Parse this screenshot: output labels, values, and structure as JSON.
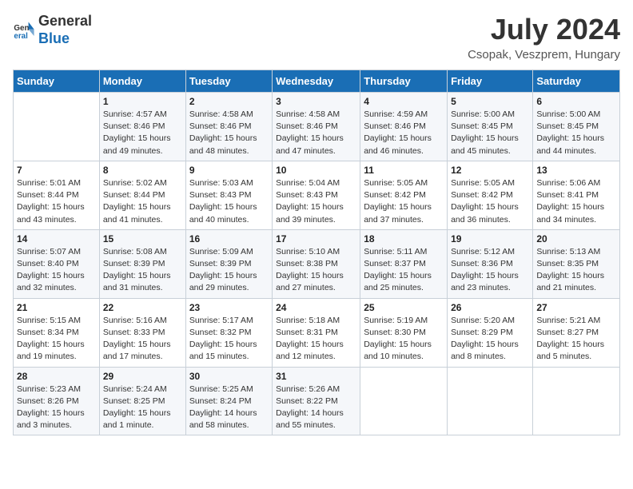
{
  "logo": {
    "text_general": "General",
    "text_blue": "Blue"
  },
  "header": {
    "month": "July 2024",
    "location": "Csopak, Veszprem, Hungary"
  },
  "days_of_week": [
    "Sunday",
    "Monday",
    "Tuesday",
    "Wednesday",
    "Thursday",
    "Friday",
    "Saturday"
  ],
  "weeks": [
    [
      {
        "day": "",
        "info": ""
      },
      {
        "day": "1",
        "info": "Sunrise: 4:57 AM\nSunset: 8:46 PM\nDaylight: 15 hours\nand 49 minutes."
      },
      {
        "day": "2",
        "info": "Sunrise: 4:58 AM\nSunset: 8:46 PM\nDaylight: 15 hours\nand 48 minutes."
      },
      {
        "day": "3",
        "info": "Sunrise: 4:58 AM\nSunset: 8:46 PM\nDaylight: 15 hours\nand 47 minutes."
      },
      {
        "day": "4",
        "info": "Sunrise: 4:59 AM\nSunset: 8:46 PM\nDaylight: 15 hours\nand 46 minutes."
      },
      {
        "day": "5",
        "info": "Sunrise: 5:00 AM\nSunset: 8:45 PM\nDaylight: 15 hours\nand 45 minutes."
      },
      {
        "day": "6",
        "info": "Sunrise: 5:00 AM\nSunset: 8:45 PM\nDaylight: 15 hours\nand 44 minutes."
      }
    ],
    [
      {
        "day": "7",
        "info": "Sunrise: 5:01 AM\nSunset: 8:44 PM\nDaylight: 15 hours\nand 43 minutes."
      },
      {
        "day": "8",
        "info": "Sunrise: 5:02 AM\nSunset: 8:44 PM\nDaylight: 15 hours\nand 41 minutes."
      },
      {
        "day": "9",
        "info": "Sunrise: 5:03 AM\nSunset: 8:43 PM\nDaylight: 15 hours\nand 40 minutes."
      },
      {
        "day": "10",
        "info": "Sunrise: 5:04 AM\nSunset: 8:43 PM\nDaylight: 15 hours\nand 39 minutes."
      },
      {
        "day": "11",
        "info": "Sunrise: 5:05 AM\nSunset: 8:42 PM\nDaylight: 15 hours\nand 37 minutes."
      },
      {
        "day": "12",
        "info": "Sunrise: 5:05 AM\nSunset: 8:42 PM\nDaylight: 15 hours\nand 36 minutes."
      },
      {
        "day": "13",
        "info": "Sunrise: 5:06 AM\nSunset: 8:41 PM\nDaylight: 15 hours\nand 34 minutes."
      }
    ],
    [
      {
        "day": "14",
        "info": "Sunrise: 5:07 AM\nSunset: 8:40 PM\nDaylight: 15 hours\nand 32 minutes."
      },
      {
        "day": "15",
        "info": "Sunrise: 5:08 AM\nSunset: 8:39 PM\nDaylight: 15 hours\nand 31 minutes."
      },
      {
        "day": "16",
        "info": "Sunrise: 5:09 AM\nSunset: 8:39 PM\nDaylight: 15 hours\nand 29 minutes."
      },
      {
        "day": "17",
        "info": "Sunrise: 5:10 AM\nSunset: 8:38 PM\nDaylight: 15 hours\nand 27 minutes."
      },
      {
        "day": "18",
        "info": "Sunrise: 5:11 AM\nSunset: 8:37 PM\nDaylight: 15 hours\nand 25 minutes."
      },
      {
        "day": "19",
        "info": "Sunrise: 5:12 AM\nSunset: 8:36 PM\nDaylight: 15 hours\nand 23 minutes."
      },
      {
        "day": "20",
        "info": "Sunrise: 5:13 AM\nSunset: 8:35 PM\nDaylight: 15 hours\nand 21 minutes."
      }
    ],
    [
      {
        "day": "21",
        "info": "Sunrise: 5:15 AM\nSunset: 8:34 PM\nDaylight: 15 hours\nand 19 minutes."
      },
      {
        "day": "22",
        "info": "Sunrise: 5:16 AM\nSunset: 8:33 PM\nDaylight: 15 hours\nand 17 minutes."
      },
      {
        "day": "23",
        "info": "Sunrise: 5:17 AM\nSunset: 8:32 PM\nDaylight: 15 hours\nand 15 minutes."
      },
      {
        "day": "24",
        "info": "Sunrise: 5:18 AM\nSunset: 8:31 PM\nDaylight: 15 hours\nand 12 minutes."
      },
      {
        "day": "25",
        "info": "Sunrise: 5:19 AM\nSunset: 8:30 PM\nDaylight: 15 hours\nand 10 minutes."
      },
      {
        "day": "26",
        "info": "Sunrise: 5:20 AM\nSunset: 8:29 PM\nDaylight: 15 hours\nand 8 minutes."
      },
      {
        "day": "27",
        "info": "Sunrise: 5:21 AM\nSunset: 8:27 PM\nDaylight: 15 hours\nand 5 minutes."
      }
    ],
    [
      {
        "day": "28",
        "info": "Sunrise: 5:23 AM\nSunset: 8:26 PM\nDaylight: 15 hours\nand 3 minutes."
      },
      {
        "day": "29",
        "info": "Sunrise: 5:24 AM\nSunset: 8:25 PM\nDaylight: 15 hours\nand 1 minute."
      },
      {
        "day": "30",
        "info": "Sunrise: 5:25 AM\nSunset: 8:24 PM\nDaylight: 14 hours\nand 58 minutes."
      },
      {
        "day": "31",
        "info": "Sunrise: 5:26 AM\nSunset: 8:22 PM\nDaylight: 14 hours\nand 55 minutes."
      },
      {
        "day": "",
        "info": ""
      },
      {
        "day": "",
        "info": ""
      },
      {
        "day": "",
        "info": ""
      }
    ]
  ]
}
